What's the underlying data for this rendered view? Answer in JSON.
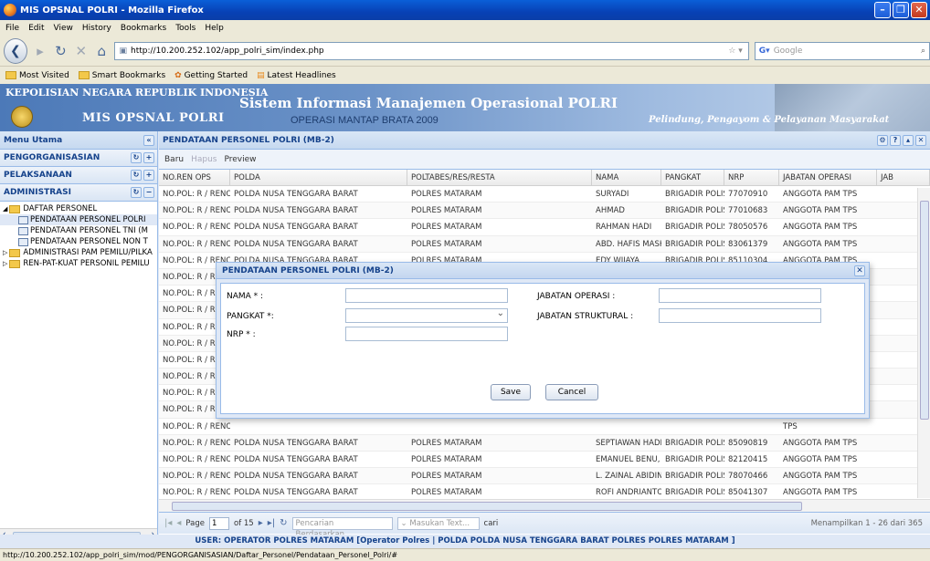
{
  "browser": {
    "title": "MIS OPSNAL POLRI - Mozilla Firefox",
    "menu": [
      "File",
      "Edit",
      "View",
      "History",
      "Bookmarks",
      "Tools",
      "Help"
    ],
    "url": "http://10.200.252.102/app_polri_sim/index.php",
    "search_placeholder": "Google",
    "bookmarks": [
      "Most Visited",
      "Smart Bookmarks",
      "Getting Started",
      "Latest Headlines"
    ],
    "status_url": "http://10.200.252.102/app_polri_sim/mod/PENGORGANISASIAN/Daftar_Personel/Pendataan_Personel_Polri/#"
  },
  "header": {
    "org": "KEPOLISIAN NEGARA REPUBLIK INDONESIA",
    "app_short": "MIS OPSNAL POLRI",
    "system_name": "Sistem Informasi Manajemen Operasional POLRI",
    "operation": "OPERASI MANTAP BRATA 2009",
    "motto": "Pelindung, Pengayom & Pelayanan Masyarakat"
  },
  "sidebar": {
    "title": "Menu Utama",
    "sections": [
      "PENGORGANISASIAN",
      "PELAKSANAAN",
      "ADMINISTRASI"
    ],
    "tree": [
      {
        "label": "DAFTAR PERSONEL",
        "level": 0
      },
      {
        "label": "PENDATAAN PERSONEL POLRI",
        "level": 1
      },
      {
        "label": "PENDATAAN PERSONEL TNI (M",
        "level": 1
      },
      {
        "label": "PENDATAAN PERSONEL NON T",
        "level": 1
      },
      {
        "label": "ADMINISTRASI PAM PEMILU/PILKA",
        "level": 0
      },
      {
        "label": "REN-PAT-KUAT PERSONIL PEMILU",
        "level": 0
      }
    ]
  },
  "main": {
    "title": "PENDATAAN PERSONEL POLRI (MB-2)",
    "toolbar": {
      "baru": "Baru",
      "hapus": "Hapus",
      "preview": "Preview"
    },
    "columns": [
      "NO.REN OPS",
      "POLDA",
      "POLTABES/RES/RESTA",
      "NAMA",
      "PANGKAT",
      "NRP",
      "JABATAN OPERASI",
      "JAB"
    ],
    "rows": [
      [
        "NO.POL: R / RENOP",
        "POLDA NUSA TENGGARA BARAT",
        "POLRES MATARAM",
        "SURYADI",
        "BRIGADIR POLISI D",
        "77070910",
        "ANGGOTA PAM TPS"
      ],
      [
        "NO.POL: R / RENOP",
        "POLDA NUSA TENGGARA BARAT",
        "POLRES MATARAM",
        "AHMAD",
        "BRIGADIR POLISI D",
        "77010683",
        "ANGGOTA PAM TPS"
      ],
      [
        "NO.POL: R / RENOP",
        "POLDA NUSA TENGGARA BARAT",
        "POLRES MATARAM",
        "RAHMAN HADI",
        "BRIGADIR POLISI D",
        "78050576",
        "ANGGOTA PAM TPS"
      ],
      [
        "NO.POL: R / RENOP",
        "POLDA NUSA TENGGARA BARAT",
        "POLRES MATARAM",
        "ABD. HAFIS MASKI",
        "BRIGADIR POLISI D",
        "83061379",
        "ANGGOTA PAM TPS"
      ],
      [
        "NO.POL: R / RENOP",
        "POLDA NUSA TENGGARA BARAT",
        "POLRES MATARAM",
        "EDY WIJAYA",
        "BRIGADIR POLISI D",
        "85110304",
        "ANGGOTA PAM TPS"
      ],
      [
        "NO.POL: R / RENOP",
        "",
        "",
        "",
        "",
        "",
        "TPS"
      ],
      [
        "NO.POL: R / RENOP",
        "",
        "",
        "",
        "",
        "",
        "TPS"
      ],
      [
        "NO.POL: R / RENOP",
        "",
        "",
        "",
        "",
        "",
        "TPS"
      ],
      [
        "NO.POL: R / RENOP",
        "",
        "",
        "",
        "",
        "",
        "TPS"
      ],
      [
        "NO.POL: R / RENOP",
        "",
        "",
        "",
        "",
        "",
        "TPS"
      ],
      [
        "NO.POL: R / RENOP",
        "",
        "",
        "",
        "",
        "",
        "TPS"
      ],
      [
        "NO.POL: R / RENOP",
        "",
        "",
        "",
        "",
        "",
        "TPS"
      ],
      [
        "NO.POL: R / RENOP",
        "",
        "",
        "",
        "",
        "",
        "TPS"
      ],
      [
        "NO.POL: R / RENOP",
        "",
        "",
        "",
        "",
        "",
        "TPS"
      ],
      [
        "NO.POL: R / RENOP",
        "",
        "",
        "",
        "",
        "",
        "TPS"
      ],
      [
        "NO.POL: R / RENOP",
        "POLDA NUSA TENGGARA BARAT",
        "POLRES MATARAM",
        "SEPTIAWAN HADI I",
        "BRIGADIR POLISI D",
        "85090819",
        "ANGGOTA PAM TPS"
      ],
      [
        "NO.POL: R / RENOP",
        "POLDA NUSA TENGGARA BARAT",
        "POLRES MATARAM",
        "EMANUEL BENU, SI",
        "BRIGADIR POLISI D",
        "82120415",
        "ANGGOTA PAM TPS"
      ],
      [
        "NO.POL: R / RENOP",
        "POLDA NUSA TENGGARA BARAT",
        "POLRES MATARAM",
        "L. ZAINAL ABIDIN",
        "BRIGADIR POLISI D",
        "78070466",
        "ANGGOTA PAM TPS"
      ],
      [
        "NO.POL: R / RENOP",
        "POLDA NUSA TENGGARA BARAT",
        "POLRES MATARAM",
        "ROFI ANDRIANTO",
        "BRIGADIR POLISI D",
        "85041307",
        "ANGGOTA PAM TPS"
      ],
      [
        "NO.POL: R / RENOP",
        "POLDA NUSA TENGGARA BARAT",
        "POLRES MATARAM",
        "APRIYANA NURDIY",
        "BRIGADIR POLISI D",
        "88040340",
        "ANGGOTA PAM TPS"
      ]
    ],
    "pager": {
      "page_label": "Page",
      "page_value": "1",
      "of_label": "of 15",
      "search_placeholder": "Pencarian Berdasarkan...",
      "text_placeholder": "Masukan Text...",
      "cari": "cari",
      "info": "Menampilkan 1 - 26 dari 365"
    }
  },
  "user_line": "USER: OPERATOR POLRES MATARAM [Operator Polres | POLDA POLDA NUSA TENGGARA BARAT POLRES POLRES MATARAM ]",
  "modal": {
    "title": "PENDATAAN PERSONEL POLRI (MB-2)",
    "nama_label": "NAMA * :",
    "pangkat_label": "PANGKAT *:",
    "nrp_label": "NRP * :",
    "jabatan_operasi_label": "JABATAN OPERASI :",
    "jabatan_struktural_label": "JABATAN STRUKTURAL :",
    "save": "Save",
    "cancel": "Cancel"
  }
}
